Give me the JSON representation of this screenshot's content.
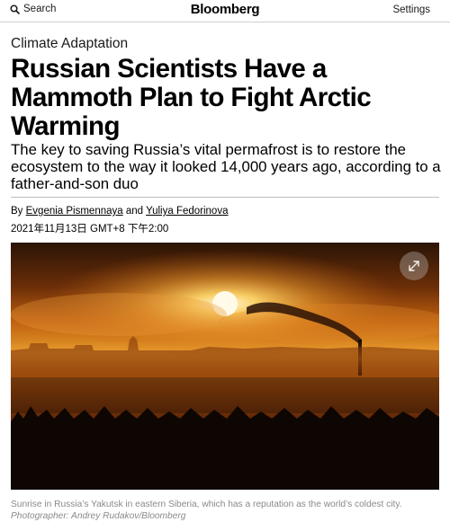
{
  "header": {
    "search_label": "Search",
    "brand": "Bloomberg",
    "settings_label": "Settings"
  },
  "article": {
    "kicker": "Climate Adaptation",
    "headline": "Russian Scientists Have a Mammoth Plan to Fight Arctic Warming",
    "dek": "The key to saving Russia’s vital permafrost is to restore the ecosystem to the way it looked 14,000 years ago, according to a father-and-son duo",
    "byline": {
      "prefix": "By",
      "author1": "Evgenia Pismennaya",
      "conjunction": "and",
      "author2": "Yuliya Fedorinova"
    },
    "date": "2021年11月13日 GMT+8 下午2:00"
  },
  "photo": {
    "caption": "Sunrise in Russia’s Yakutsk in eastern Siberia, which has a reputation as the world’s coldest city.",
    "credit": "Photographer: Andrey Rudakov/Bloomberg",
    "expand_icon": "expand-icon"
  }
}
